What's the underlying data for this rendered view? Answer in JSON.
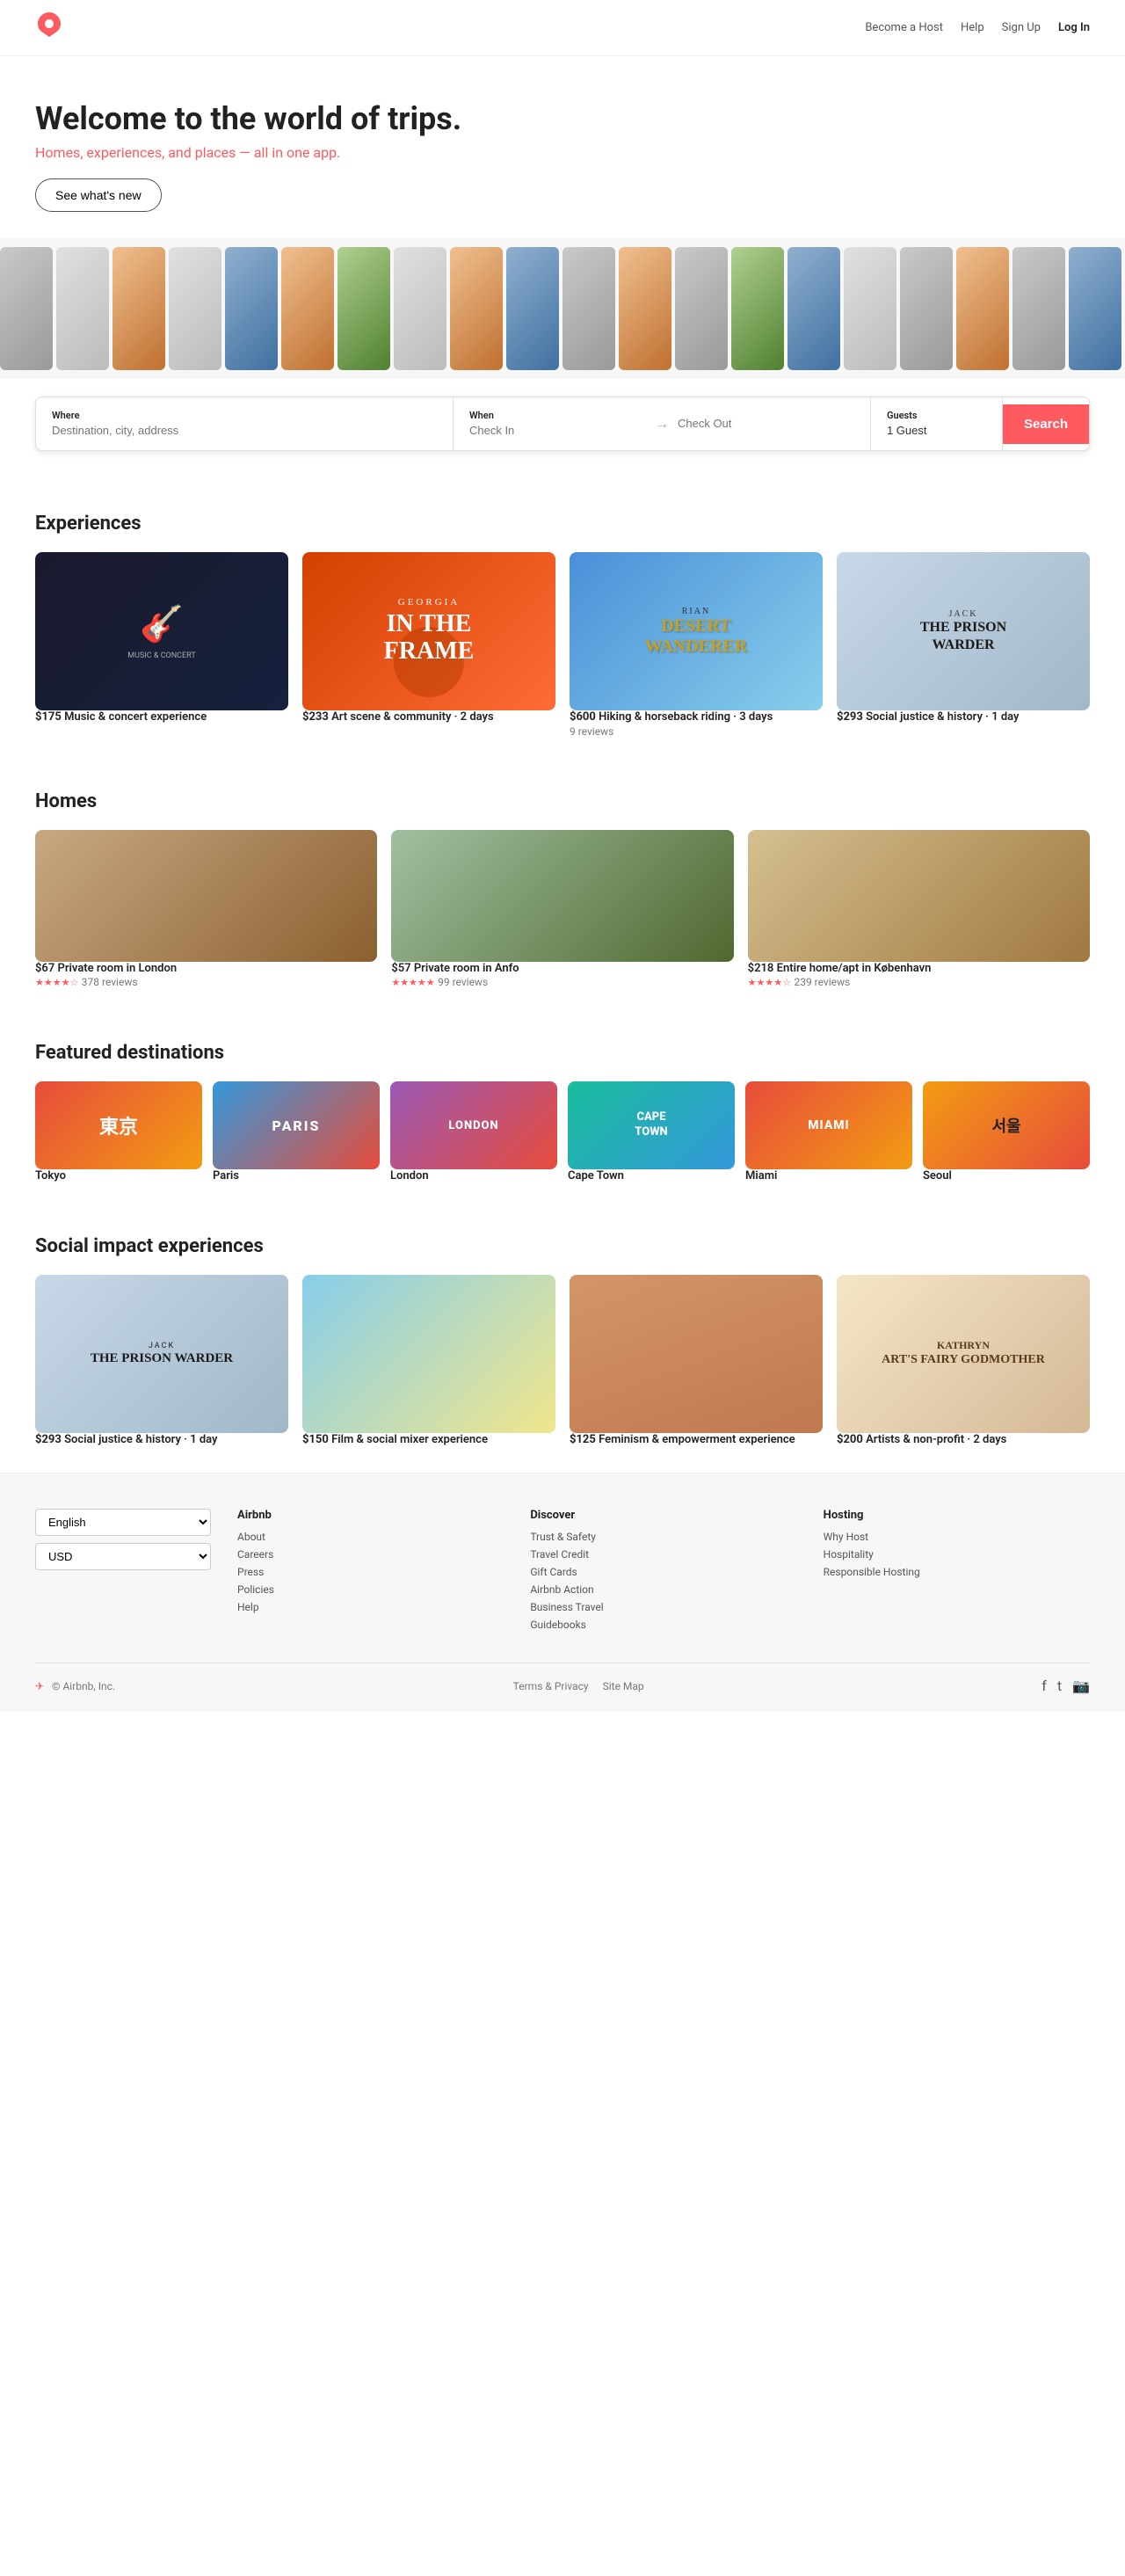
{
  "nav": {
    "logo": "✈",
    "links": [
      "Become a Host",
      "Help",
      "Sign Up",
      "Log In"
    ]
  },
  "hero": {
    "title": "Welcome to the world of trips.",
    "subtitle_pre": "Homes, experiences, and places — ",
    "subtitle_highlight": "all in",
    "subtitle_post": " one app.",
    "cta_label": "See what's new"
  },
  "search": {
    "where_label": "Where",
    "where_placeholder": "Destination, city, address",
    "when_label": "When",
    "checkin_placeholder": "Check In",
    "checkout_placeholder": "Check Out",
    "guests_label": "Guests",
    "guests_value": "1 Guest",
    "search_label": "Search"
  },
  "experiences": {
    "section_title": "Experiences",
    "cards": [
      {
        "price": "$175",
        "desc": "Music & concert experience",
        "label": "Music & concert experience"
      },
      {
        "price": "$233",
        "desc": "Art scene & community · 2 days",
        "title_top": "GEORGIA",
        "title_main": "IN THE FRAME",
        "label": "Art scene & community"
      },
      {
        "price": "$600",
        "desc": "Hiking & horseback riding · 3 days",
        "reviews": "9 reviews",
        "title_top": "RIAN",
        "title_main": "DESERT WANDERER",
        "label": "Hiking & horseback riding"
      },
      {
        "price": "$293",
        "desc": "Social justice & history · 1 day",
        "title_top": "JACK",
        "title_main": "THE PRISON WARDER",
        "label": "Social justice & history"
      }
    ]
  },
  "homes": {
    "section_title": "Homes",
    "cards": [
      {
        "price": "$67",
        "desc": "Private room in London",
        "rating": "★★★★☆",
        "reviews": "378 reviews"
      },
      {
        "price": "$57",
        "desc": "Private room in Anfo",
        "rating": "★★★★★",
        "reviews": "99 reviews"
      },
      {
        "price": "$218",
        "desc": "Entire home/apt in København",
        "rating": "★★★★☆",
        "reviews": "239 reviews"
      }
    ]
  },
  "destinations": {
    "section_title": "Featured destinations",
    "items": [
      {
        "name": "Tokyo",
        "display": "東京"
      },
      {
        "name": "Paris",
        "display": "PARIS"
      },
      {
        "name": "London",
        "display": "LONDON"
      },
      {
        "name": "Cape Town",
        "display": "CAPE TOWN"
      },
      {
        "name": "Miami",
        "display": "MIAMI"
      },
      {
        "name": "Seoul",
        "display": "서울"
      }
    ]
  },
  "social_impact": {
    "section_title": "Social impact experiences",
    "cards": [
      {
        "price": "$293",
        "desc": "Social justice & history · 1 day",
        "title_top": "JACK",
        "title_main": "THE PRISON WARDER"
      },
      {
        "price": "$150",
        "desc": "Film & social mixer experience"
      },
      {
        "price": "$125",
        "desc": "Feminism & empowerment experience"
      },
      {
        "price": "$200",
        "desc": "Artists & non-profit · 2 days",
        "title_name": "KATHRYN",
        "title_sub": "ART'S FAIRY GODMOTHER"
      }
    ]
  },
  "footer": {
    "language_label": "English",
    "currency_label": "USD",
    "airbnb_col": {
      "title": "Airbnb",
      "links": [
        "About",
        "Careers",
        "Press",
        "Policies",
        "Help"
      ]
    },
    "discover_col": {
      "title": "Discover",
      "links": [
        "Trust & Safety",
        "Travel Credit",
        "Gift Cards",
        "Airbnb Action",
        "Business Travel",
        "Guidebooks"
      ]
    },
    "hosting_col": {
      "title": "Hosting",
      "links": [
        "Why Host",
        "Hospitality",
        "Responsible Hosting"
      ]
    },
    "copyright": "© Airbnb, Inc.",
    "bottom_links": [
      "Terms & Privacy",
      "Site Map"
    ],
    "social_icons": [
      "f",
      "t",
      "📷"
    ]
  }
}
